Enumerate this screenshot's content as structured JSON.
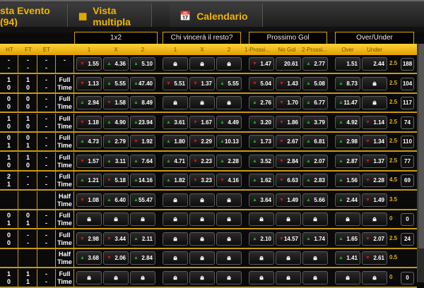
{
  "tabs": [
    {
      "label": "sta Evento (94)",
      "icon": ""
    },
    {
      "label": "Vista multipla",
      "icon": "grid-icon"
    },
    {
      "label": "Calendario",
      "icon": "calendar-icon"
    }
  ],
  "groups": [
    "1x2",
    "Chi vincerà il resto?",
    "Prossimo Gol",
    "Over/Under"
  ],
  "columns": {
    "ht": "HT",
    "ft": "FT",
    "et": "ET",
    "c1x2": [
      "1",
      "X",
      "2"
    ],
    "chi": [
      "1",
      "X",
      "2"
    ],
    "pross": [
      "1-Prossi...",
      "No Gol",
      "2-Prossi..."
    ],
    "ou": [
      "Over",
      "Under"
    ]
  },
  "colors": {
    "accent": "#f0b400",
    "up": "#1fa81f",
    "down": "#d01818"
  },
  "rows": [
    {
      "ht": [
        "-",
        "-"
      ],
      "ft": [
        "-",
        "-"
      ],
      "et": [
        "-",
        "-"
      ],
      "period": "-",
      "odds": [
        "d1.55",
        "u4.36",
        "u5.10",
        "L",
        "L",
        "L",
        "d1.47",
        "n20.61",
        "u2.77",
        "n1.51",
        "n2.44"
      ],
      "line": "2.5",
      "count": "188"
    },
    {
      "ht": [
        "1",
        "0"
      ],
      "ft": [
        "1",
        "0"
      ],
      "et": [
        "-",
        "-"
      ],
      "period": "Full Time",
      "odds": [
        "d1.13",
        "u5.55",
        "u47.40",
        "d5.51",
        "d1.37",
        "u5.55",
        "d5.04",
        "d1.43",
        "u5.08",
        "u8.73",
        "L"
      ],
      "line": "2.5",
      "count": "104"
    },
    {
      "ht": [
        "0",
        "0"
      ],
      "ft": [
        "0",
        "0"
      ],
      "et": [
        "-",
        "-"
      ],
      "period": "Full Time",
      "odds": [
        "u2.94",
        "d1.58",
        "u8.49",
        "L",
        "L",
        "L",
        "u2.76",
        "d1.70",
        "u6.77",
        "u11.47",
        "L"
      ],
      "line": "2.5",
      "count": "117"
    },
    {
      "ht": [
        "1",
        "0"
      ],
      "ft": [
        "1",
        "0"
      ],
      "et": [
        "-",
        "-"
      ],
      "period": "Full Time",
      "odds": [
        "d1.18",
        "u4.90",
        "u23.94",
        "u3.61",
        "d1.67",
        "u4.49",
        "u3.20",
        "d1.86",
        "u3.79",
        "u4.92",
        "d1.14"
      ],
      "line": "2.5",
      "count": "74"
    },
    {
      "ht": [
        "0",
        "1"
      ],
      "ft": [
        "0",
        "1"
      ],
      "et": [
        "-",
        "-"
      ],
      "period": "Full Time",
      "odds": [
        "u4.73",
        "u2.79",
        "d1.92",
        "u1.80",
        "d2.29",
        "u10.13",
        "u1.73",
        "d2.67",
        "u6.81",
        "u2.98",
        "d1.34"
      ],
      "line": "2.5",
      "count": "110"
    },
    {
      "ht": [
        "1",
        "0"
      ],
      "ft": [
        "1",
        "0"
      ],
      "et": [
        "-",
        "-"
      ],
      "period": "Full Time",
      "odds": [
        "d1.57",
        "u3.11",
        "u7.64",
        "u4.71",
        "d2.23",
        "u2.28",
        "u3.52",
        "d2.84",
        "u2.07",
        "u2.87",
        "d1.37"
      ],
      "line": "2.5",
      "count": "77"
    },
    {
      "ht": [
        "2",
        "1"
      ],
      "ft": [
        "-",
        "-"
      ],
      "et": [
        "-",
        "-"
      ],
      "period": "Full Time",
      "odds": [
        "u1.21",
        "d5.18",
        "u14.16",
        "u1.82",
        "d3.23",
        "d4.16",
        "u1.62",
        "d6.63",
        "u2.83",
        "u1.56",
        "d2.28"
      ],
      "line": "4.5",
      "count": "69"
    },
    {
      "ht": [
        "",
        ""
      ],
      "ft": [
        "",
        ""
      ],
      "et": [
        "",
        ""
      ],
      "period": "Half Time",
      "odds": [
        "d1.08",
        "u6.40",
        "u55.47",
        "L",
        "L",
        "L",
        "u3.64",
        "d1.49",
        "u5.66",
        "u2.44",
        "d1.49"
      ],
      "line": "3.5",
      "count": ""
    },
    {
      "ht": [
        "0",
        "1"
      ],
      "ft": [
        "0",
        "1"
      ],
      "et": [
        "-",
        "-"
      ],
      "period": "Full Time",
      "odds": [
        "L",
        "L",
        "L",
        "L",
        "L",
        "L",
        "L",
        "L",
        "L",
        "L",
        "L"
      ],
      "line": "0",
      "count": "0"
    },
    {
      "ht": [
        "0",
        "0"
      ],
      "ft": [
        "-",
        "-"
      ],
      "et": [
        "-",
        "-"
      ],
      "period": "Full Time",
      "odds": [
        "d2.98",
        "d3.44",
        "u2.11",
        "L",
        "L",
        "L",
        "u2.10",
        "d14.57",
        "u1.74",
        "u1.65",
        "d2.07"
      ],
      "line": "2.5",
      "count": "24"
    },
    {
      "ht": [
        "",
        ""
      ],
      "ft": [
        "",
        ""
      ],
      "et": [
        "",
        ""
      ],
      "period": "Half Time",
      "odds": [
        "u3.68",
        "d2.06",
        "u2.84",
        "L",
        "L",
        "L",
        "L",
        "L",
        "L",
        "u1.41",
        "d2.61"
      ],
      "line": "0.5",
      "count": ""
    },
    {
      "ht": [
        "1",
        "0"
      ],
      "ft": [
        "1",
        "1"
      ],
      "et": [
        "-",
        "-"
      ],
      "period": "Full Time",
      "odds": [
        "L",
        "L",
        "L",
        "L",
        "L",
        "L",
        "L",
        "L",
        "L",
        "L",
        "L"
      ],
      "line": "0",
      "count": "0"
    }
  ]
}
